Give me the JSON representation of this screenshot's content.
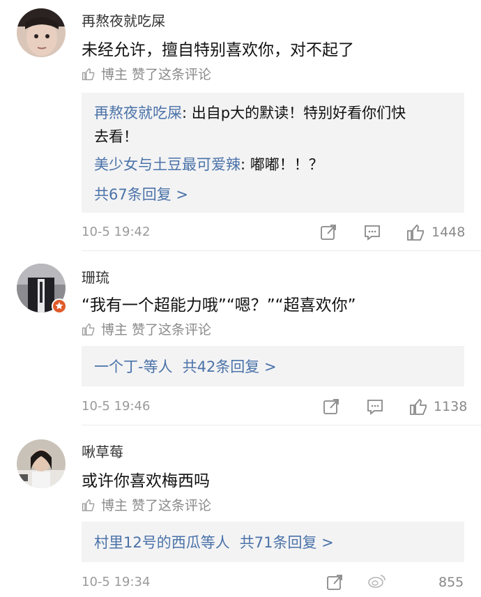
{
  "comments": [
    {
      "username": "再熬夜就吃屎",
      "text": "未经允许，擅自特别喜欢你，对不起了",
      "liked_by_author": "博主 赞了这条评论",
      "replies": [
        {
          "name": "再熬夜就吃屎",
          "sep": ": ",
          "text_line1": "出自p大的默读！特别好看你们快",
          "text_line2": "去看！"
        },
        {
          "name": "美少女与土豆最可爱辣",
          "sep": ": ",
          "text_line1": "嘟嘟！！？"
        }
      ],
      "more_replies": "共67条回复 >",
      "time": "10-5 19:42",
      "likes": "1448"
    },
    {
      "username": "珊琉",
      "text": "“我有一个超能力哦”“嗯？”“超喜欢你”",
      "liked_by_author": "博主 赞了这条评论",
      "reply_names": "一个丁-等人",
      "more_replies": "共42条回复 >",
      "time": "10-5 19:46",
      "likes": "1138"
    },
    {
      "username": "啾草莓",
      "text": "或许你喜欢梅西吗",
      "liked_by_author": "博主 赞了这条评论",
      "reply_names": "村里12号的西瓜等人",
      "more_replies": "共71条回复 >",
      "time": "10-5 19:34",
      "likes": "855"
    }
  ],
  "colors": {
    "link": "#4a72a8",
    "reply_bg": "#f3f3f4",
    "muted": "#9a9a9a"
  },
  "icons": [
    "thumb-up-icon",
    "share-icon",
    "comment-icon",
    "like-icon",
    "weibo-logo-icon",
    "vip-badge-icon"
  ]
}
